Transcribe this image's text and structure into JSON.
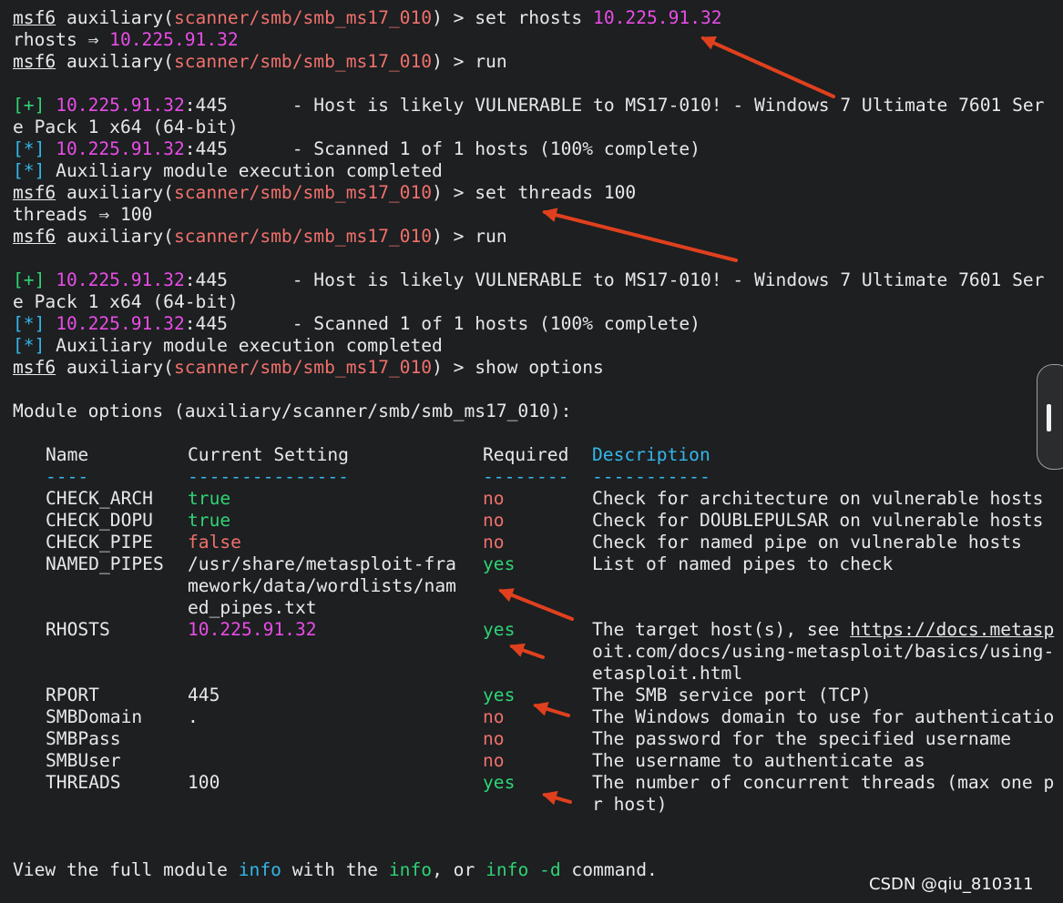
{
  "prompt": {
    "app": "msf6",
    "mod_pre": "auxiliary(",
    "mod_path": "scanner/smb/smb_ms17_010",
    "mod_post": ") > "
  },
  "cmd1": {
    "text": "set rhosts ",
    "value": "10.225.91.32"
  },
  "echo1": {
    "label": "rhosts ⇒ ",
    "value": "10.225.91.32"
  },
  "cmd_run": "run",
  "result": {
    "plus": "[+]",
    "star": "[*]",
    "ip": "10.225.91.32",
    "port": ":445",
    "vuln_msg": "      - Host is likely VULNERABLE to MS17-010! - Windows 7 Ultimate 7601 Ser",
    "vuln_wrap": "e Pack 1 x64 (64-bit)",
    "scan_msg": "      - Scanned 1 of 1 hosts (100% complete)",
    "done_msg": " Auxiliary module execution completed"
  },
  "cmd2": "set threads 100",
  "echo2": "threads ⇒ 100",
  "cmd3": "show options",
  "module_options_title": "Module options (auxiliary/scanner/smb/smb_ms17_010):",
  "table": {
    "headers": [
      "Name",
      "Current Setting",
      "Required",
      "Description"
    ],
    "underlines": [
      "----",
      "---------------",
      "--------",
      "-----------"
    ],
    "rows": [
      {
        "name": "CHECK_ARCH",
        "setting": [
          "true"
        ],
        "required": "no",
        "description": [
          "Check for architecture on vulnerable hosts"
        ]
      },
      {
        "name": "CHECK_DOPU",
        "setting": [
          "true"
        ],
        "required": "no",
        "description": [
          "Check for DOUBLEPULSAR on vulnerable hosts"
        ]
      },
      {
        "name": "CHECK_PIPE",
        "setting": [
          "false"
        ],
        "required": "no",
        "description": [
          "Check for named pipe on vulnerable hosts"
        ]
      },
      {
        "name": "NAMED_PIPES",
        "setting": [
          "/usr/share/metasploit-fra",
          "mework/data/wordlists/nam",
          "ed_pipes.txt"
        ],
        "required": "yes",
        "description": [
          "List of named pipes to check"
        ]
      },
      {
        "name": "RHOSTS",
        "setting": [
          "10.225.91.32"
        ],
        "required": "yes",
        "description": [
          "The target host(s), see ",
          "oit.com/docs/using-metasploit/basics/using-",
          "etasploit.html"
        ],
        "description_link": "https://docs.metasp"
      },
      {
        "name": "RPORT",
        "setting": [
          "445"
        ],
        "required": "yes",
        "description": [
          "The SMB service port (TCP)"
        ]
      },
      {
        "name": "SMBDomain",
        "setting": [
          "."
        ],
        "required": "no",
        "description": [
          "The Windows domain to use for authenticatio"
        ]
      },
      {
        "name": "SMBPass",
        "setting": [
          ""
        ],
        "required": "no",
        "description": [
          "The password for the specified username"
        ]
      },
      {
        "name": "SMBUser",
        "setting": [
          ""
        ],
        "required": "no",
        "description": [
          "The username to authenticate as"
        ]
      },
      {
        "name": "THREADS",
        "setting": [
          "100"
        ],
        "required": "yes",
        "description": [
          "The number of concurrent threads (max one p",
          "r host)"
        ]
      }
    ]
  },
  "footer": {
    "p1": "View the full module ",
    "info1": "info",
    "p2": " with the ",
    "info2": "info",
    "p3": ", or ",
    "info3": "info -d",
    "p4": " command."
  },
  "watermark": "CSDN @qiu_810311",
  "colors": {
    "background": "#1d1f21",
    "text": "#e8e8e8",
    "path": "#f0706b",
    "ip": "#e94ce6",
    "good": "#2fd374",
    "info": "#35b6e8",
    "arrow": "#e0401e"
  }
}
